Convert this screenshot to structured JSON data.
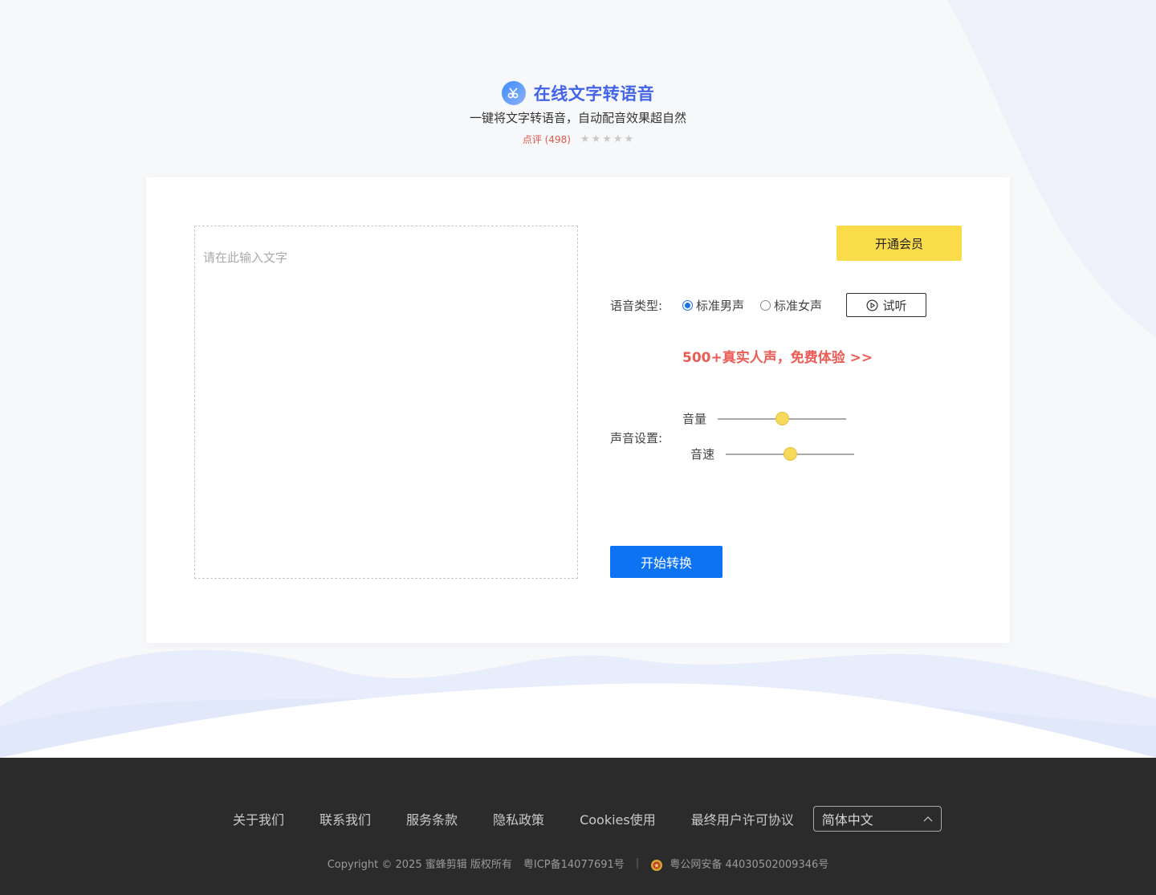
{
  "hero": {
    "title": "在线文字转语音",
    "subtitle": "一键将文字转语音，自动配音效果超自然",
    "review_text": "点评 (498)",
    "stars": [
      "★",
      "★",
      "★",
      "★",
      "★"
    ]
  },
  "editor": {
    "placeholder": "请在此输入文字"
  },
  "vip": {
    "label": "开通会员"
  },
  "voice": {
    "label": "语音类型:",
    "options": [
      "标准男声",
      "标准女声"
    ],
    "selected": "标准男声",
    "preview_label": "试听"
  },
  "promo": {
    "text": "500+真实人声，免费体验 >>"
  },
  "sound": {
    "label": "声音设置:",
    "volume_label": "音量",
    "volume_fraction": 0.5,
    "speed_label": "音速",
    "speed_fraction": 0.5
  },
  "convert": {
    "label": "开始转换"
  },
  "footer": {
    "links": [
      "关于我们",
      "联系我们",
      "服务条款",
      "隐私政策",
      "Cookies使用",
      "最终用户许可协议"
    ],
    "language": "简体中文",
    "copyright": "Copyright © 2025 蜜蜂剪辑 版权所有",
    "icp": "粤ICP备14077691号",
    "divider": "|",
    "police": "粤公网安备 44030502009346号"
  },
  "colors": {
    "brand_blue": "#4264e8",
    "accent_yellow": "#fadb4a",
    "primary_button": "#0d73f2",
    "promo_red": "#ec5b55",
    "footer_bg": "#2b2b2b"
  }
}
